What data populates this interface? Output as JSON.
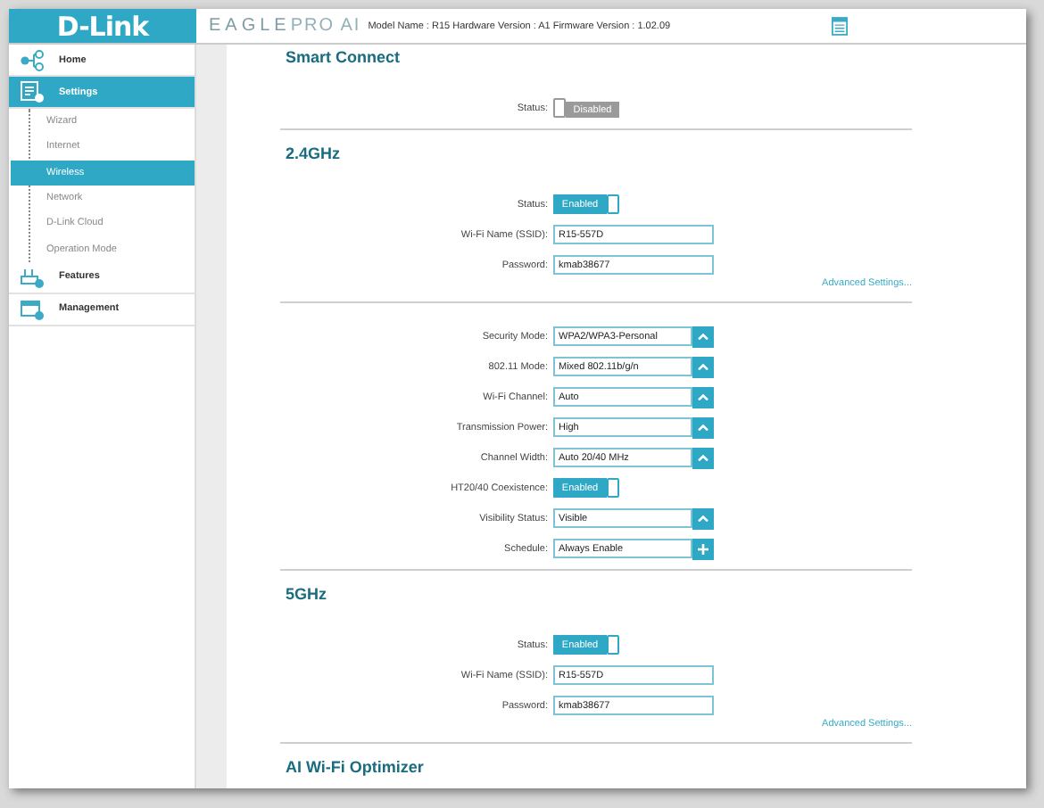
{
  "header": {
    "logo": "D-Link",
    "product_a": "EAGLE",
    "product_b": "PRO AI",
    "model_info": "Model Name : R15 Hardware Version : A1 Firmware Version : 1.02.09"
  },
  "sidebar": {
    "items": [
      {
        "label": "Home",
        "kind": "home",
        "selected": false
      },
      {
        "label": "Settings",
        "kind": "settings",
        "selected": true,
        "children": [
          {
            "label": "Wizard",
            "selected": false
          },
          {
            "label": "Internet",
            "selected": false
          },
          {
            "label": "Wireless",
            "selected": true
          },
          {
            "label": "Network",
            "selected": false
          },
          {
            "label": "D-Link Cloud",
            "selected": false
          },
          {
            "label": "Operation Mode",
            "selected": false
          }
        ]
      },
      {
        "label": "Features",
        "kind": "features",
        "selected": false
      },
      {
        "label": "Management",
        "kind": "management",
        "selected": false
      }
    ]
  },
  "sections": [
    {
      "title": "Smart Connect",
      "groups": [
        {
          "rows": [
            {
              "kind": "toggle",
              "label": "Status:",
              "value": "Disabled",
              "on": false
            }
          ]
        }
      ]
    },
    {
      "title": "2.4GHz",
      "groups": [
        {
          "rows": [
            {
              "kind": "toggle",
              "label": "Status:",
              "value": "Enabled",
              "on": true
            },
            {
              "kind": "input",
              "label": "Wi-Fi Name (SSID):",
              "value": "R15-557D"
            },
            {
              "kind": "input",
              "label": "Password:",
              "value": "kmab38677"
            }
          ],
          "link": "Advanced Settings..."
        },
        {
          "rows": [
            {
              "kind": "select",
              "label": "Security Mode:",
              "value": "WPA2/WPA3-Personal"
            },
            {
              "kind": "select",
              "label": "802.11 Mode:",
              "value": "Mixed 802.11b/g/n"
            },
            {
              "kind": "select",
              "label": "Wi-Fi Channel:",
              "value": "Auto"
            },
            {
              "kind": "select",
              "label": "Transmission Power:",
              "value": "High"
            },
            {
              "kind": "select",
              "label": "Channel Width:",
              "value": "Auto 20/40 MHz"
            },
            {
              "kind": "toggle",
              "label": "HT20/40 Coexistence:",
              "value": "Enabled",
              "on": true
            },
            {
              "kind": "select",
              "label": "Visibility Status:",
              "value": "Visible"
            },
            {
              "kind": "schedule",
              "label": "Schedule:",
              "value": "Always Enable"
            }
          ]
        }
      ]
    },
    {
      "title": "5GHz",
      "groups": [
        {
          "rows": [
            {
              "kind": "toggle",
              "label": "Status:",
              "value": "Enabled",
              "on": true
            },
            {
              "kind": "input",
              "label": "Wi-Fi Name (SSID):",
              "value": "R15-557D"
            },
            {
              "kind": "input",
              "label": "Password:",
              "value": "kmab38677"
            }
          ],
          "link": "Advanced Settings..."
        }
      ]
    },
    {
      "title": "AI Wi-Fi Optimizer"
    }
  ]
}
